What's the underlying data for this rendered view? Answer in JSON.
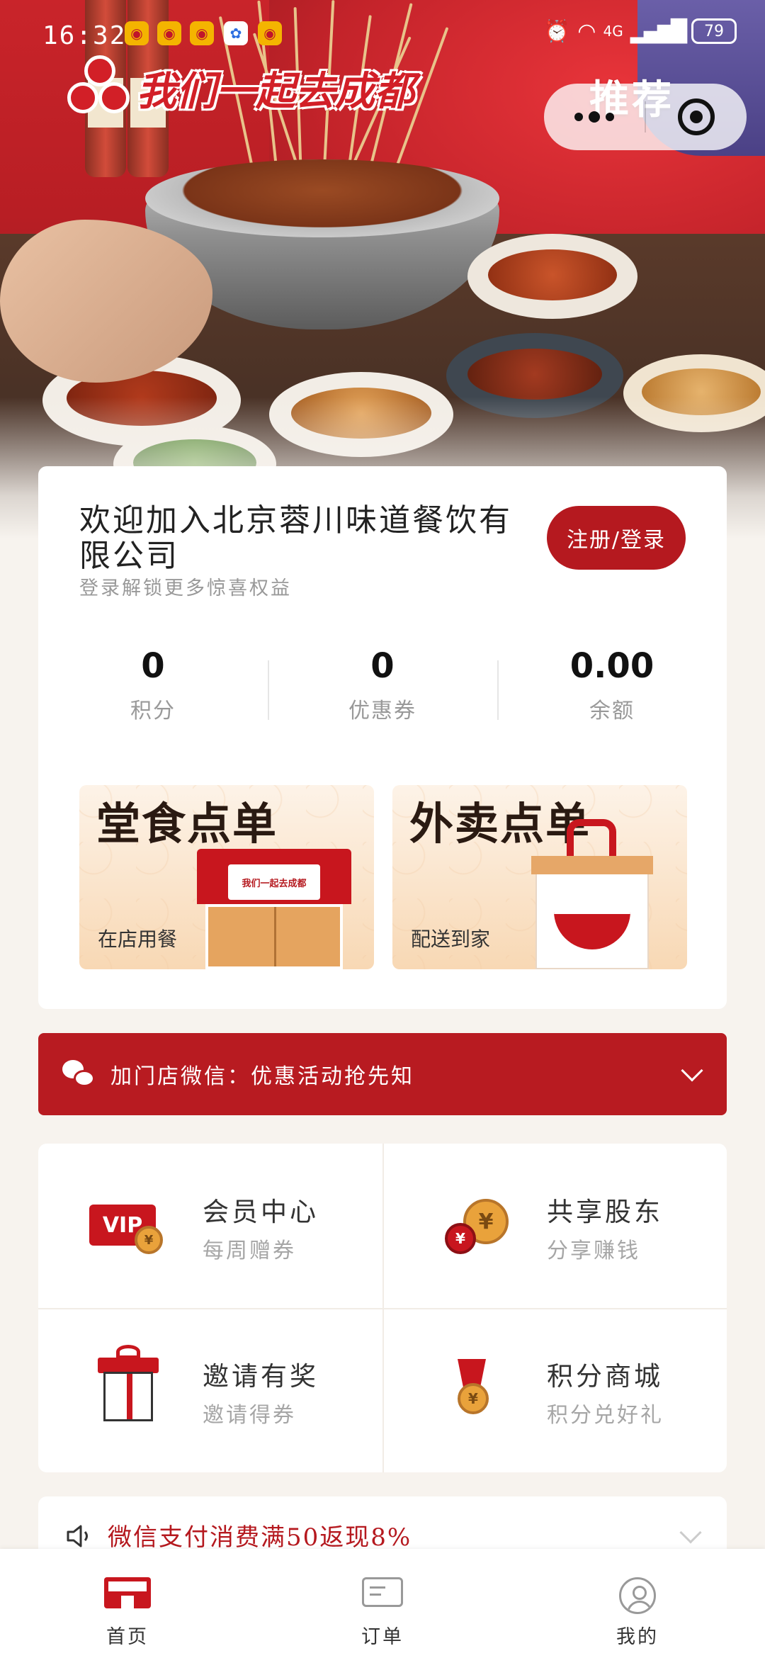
{
  "status_bar": {
    "time": "16:32",
    "network": "4G",
    "battery": "79"
  },
  "header": {
    "brand_name": "我们一起去成都",
    "capsule_label": "推荐"
  },
  "member_card": {
    "welcome": "欢迎加入北京蓉川味道餐饮有限公司",
    "subtitle": "登录解锁更多惊喜权益",
    "login_button": "注册/登录",
    "stats": [
      {
        "value": "0",
        "label": "积分"
      },
      {
        "value": "0",
        "label": "优惠券"
      },
      {
        "value": "0.00",
        "label": "余额"
      }
    ],
    "dine_in": {
      "title": "堂食点单",
      "subtitle": "在店用餐",
      "sign": "我们一起去成都"
    },
    "delivery": {
      "title": "外卖点单",
      "subtitle": "配送到家"
    }
  },
  "wechat_banner": {
    "text": "加门店微信：优惠活动抢先知"
  },
  "services": [
    {
      "title": "会员中心",
      "subtitle": "每周赠券",
      "icon": "vip-card-icon",
      "badge": "VIP"
    },
    {
      "title": "共享股东",
      "subtitle": "分享赚钱",
      "icon": "coins-icon"
    },
    {
      "title": "邀请有奖",
      "subtitle": "邀请得券",
      "icon": "gift-icon"
    },
    {
      "title": "积分商城",
      "subtitle": "积分兑好礼",
      "icon": "medal-icon"
    }
  ],
  "notice": {
    "text": "微信支付消费满50返现8%"
  },
  "tabbar": {
    "items": [
      {
        "label": "首页",
        "icon": "home-store-icon"
      },
      {
        "label": "订单",
        "icon": "order-icon"
      },
      {
        "label": "我的",
        "icon": "profile-icon"
      }
    ]
  },
  "colors": {
    "brand_red": "#b5191f",
    "background": "#f7f3ee"
  }
}
